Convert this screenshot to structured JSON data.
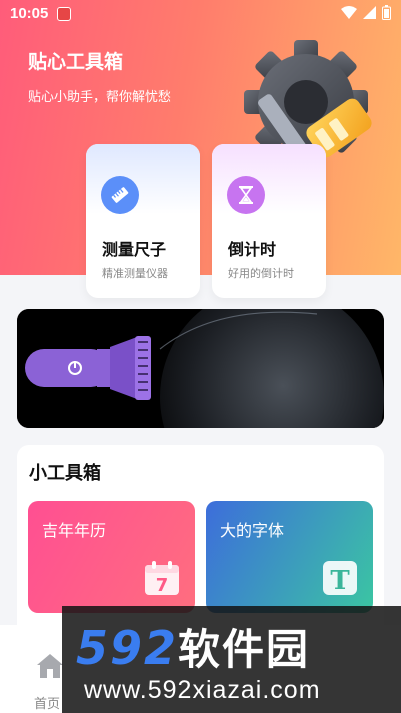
{
  "status_bar": {
    "time": "10:05"
  },
  "header": {
    "title": "贴心工具箱",
    "subtitle": "贴心小助手，帮你解忧愁"
  },
  "feature_cards": [
    {
      "name": "测量尺子",
      "desc": "精准测量仪器",
      "icon": "ruler-icon",
      "color": "#5b8ff9"
    },
    {
      "name": "倒计时",
      "desc": "好用的倒计时",
      "icon": "hourglass-icon",
      "color": "#c774f0"
    }
  ],
  "banner": {
    "icon": "flashlight-icon"
  },
  "toolbox": {
    "title": "小工具箱",
    "items": [
      {
        "label": "吉年年历",
        "icon": "calendar-icon",
        "icon_text": "7"
      },
      {
        "label": "大的字体",
        "icon": "font-icon",
        "icon_text": "T"
      }
    ]
  },
  "bottom_nav": {
    "home_label": "首页"
  },
  "watermark": {
    "logo_num": "592",
    "logo_cn": "软件园",
    "url": "www.592xiazai.com"
  }
}
